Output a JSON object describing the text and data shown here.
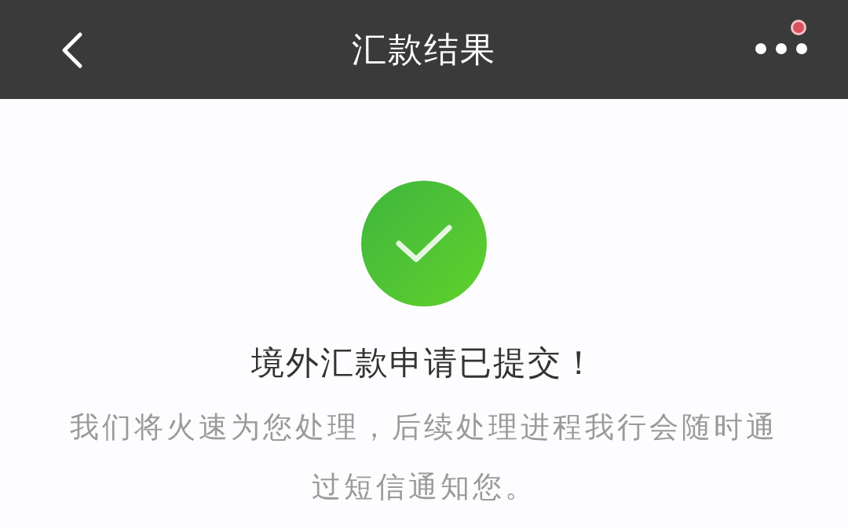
{
  "nav_bar": {
    "title": "汇款结果",
    "menu_badge": true
  },
  "result": {
    "success": true,
    "heading": "境外汇款申请已提交！",
    "message": "我们将火速为您处理，后续处理进程我行会随时通过短信通知您。"
  }
}
